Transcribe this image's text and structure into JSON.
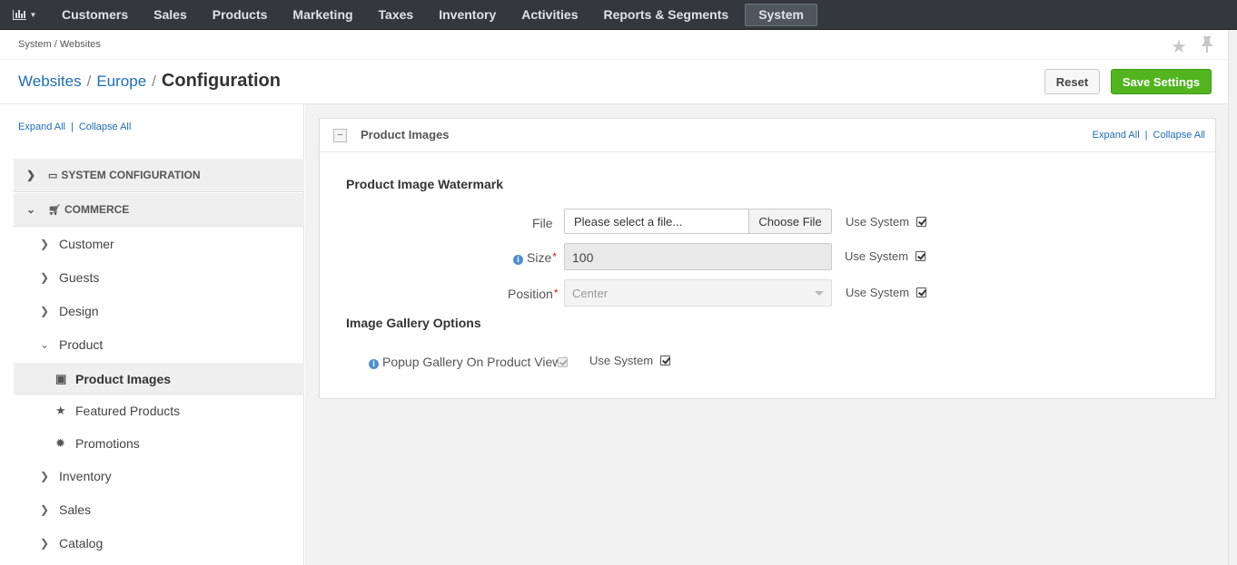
{
  "nav": {
    "items": [
      "Customers",
      "Sales",
      "Products",
      "Marketing",
      "Taxes",
      "Inventory",
      "Activities",
      "Reports & Segments",
      "System"
    ],
    "active": "System"
  },
  "breadcrumb": "System / Websites",
  "title": {
    "link1": "Websites",
    "link2": "Europe",
    "current": "Configuration",
    "sep": "/"
  },
  "actions": {
    "reset": "Reset",
    "save": "Save Settings"
  },
  "sidebar": {
    "expand_all": "Expand All",
    "collapse_all": "Collapse All",
    "heads": [
      "SYSTEM CONFIGURATION",
      "COMMERCE"
    ],
    "items": [
      "Customer",
      "Guests",
      "Design",
      "Product",
      "Inventory",
      "Sales",
      "Catalog"
    ],
    "subitems": [
      "Product Images",
      "Featured Products",
      "Promotions"
    ]
  },
  "panel": {
    "title": "Product Images",
    "expand_all": "Expand All",
    "collapse_all": "Collapse All",
    "section1": "Product Image Watermark",
    "section2": "Image Gallery Options",
    "file_label": "File",
    "file_placeholder": "Please select a file...",
    "file_button": "Choose File",
    "size_label": "Size",
    "size_value": "100",
    "position_label": "Position",
    "position_value": "Center",
    "popup_label": "Popup Gallery On Product View",
    "use_system": "Use System"
  }
}
